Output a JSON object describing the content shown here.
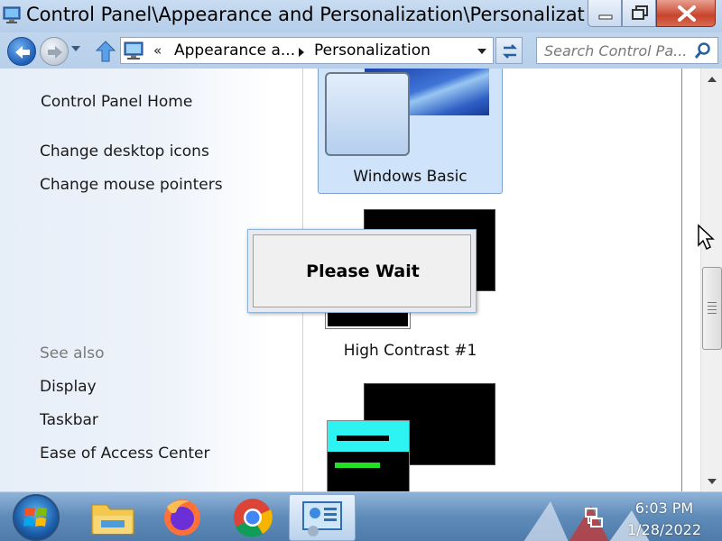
{
  "window": {
    "title": "Control Panel\\Appearance and Personalization\\Personalizat...",
    "buttons": {
      "minimize": "minimize",
      "maximize": "maximize",
      "close": "close"
    }
  },
  "navbar": {
    "breadcrumb": {
      "overflow": "«",
      "items": [
        "Appearance a...",
        "Personalization"
      ]
    },
    "search_placeholder": "Search Control Pa..."
  },
  "left_pane": {
    "home": "Control Panel Home",
    "tasks": [
      "Change desktop icons",
      "Change mouse pointers"
    ],
    "see_also_heading": "See also",
    "see_also": [
      "Display",
      "Taskbar",
      "Ease of Access Center"
    ]
  },
  "themes": [
    {
      "label": "Windows Basic",
      "selected": true
    },
    {
      "label": "High Contrast #1",
      "selected": false
    },
    {
      "label": "",
      "selected": false
    }
  ],
  "dialog": {
    "text": "Please Wait"
  },
  "taskbar": {
    "items": [
      "start-button",
      "file-explorer",
      "firefox",
      "chrome",
      "control-panel"
    ],
    "active_item": "control-panel",
    "time": "6:03 PM",
    "date": "1/28/2022"
  },
  "colors": {
    "selected_tile": "#cfe3fb",
    "high_contrast_cyan": "#2ef3f3",
    "high_contrast_green": "#22e022"
  },
  "icons": {
    "app": "control-panel-icon",
    "back": "back-arrow-icon",
    "forward": "forward-arrow-icon",
    "up": "up-arrow-icon",
    "refresh": "refresh-icon",
    "search": "search-icon",
    "network": "network-icon"
  }
}
